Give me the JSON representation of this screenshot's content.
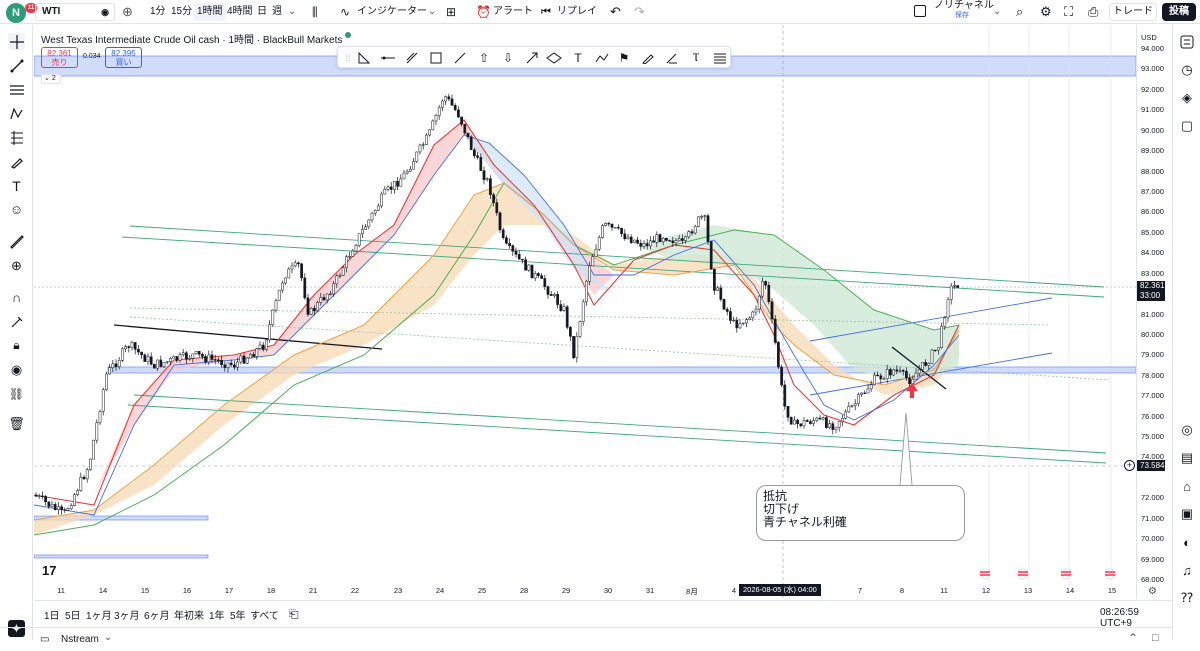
{
  "topbar": {
    "logo_letter": "N",
    "logo_badge": "11",
    "symbol": "WTI",
    "intervals": [
      "1分",
      "15分",
      "1時間",
      "4時間",
      "日",
      "週"
    ],
    "active_interval": "1時間",
    "indicators_label": "インジケーター",
    "alert_label": "アラート",
    "replay_label": "リプレイ",
    "layout_name": "ノリチャネル",
    "layout_status": "保存",
    "trade_label": "トレード",
    "publish_label": "投稿"
  },
  "legend": {
    "title": "West Texas Intermediate Crude Oil cash · 1時間 · BlackBull Markets",
    "sell_price": "82.361",
    "sell_label": "売り",
    "spread": "0.034",
    "buy_price": "82.395",
    "buy_label": "買い",
    "collapse_count": "2"
  },
  "price_axis": {
    "currency": "USD",
    "ticks": [
      "94.000",
      "93.000",
      "92.000",
      "91.000",
      "90.000",
      "89.000",
      "88.000",
      "87.000",
      "86.000",
      "85.000",
      "84.000",
      "83.000",
      "81.000",
      "80.000",
      "79.000",
      "78.000",
      "77.000",
      "76.000",
      "75.000",
      "74.000",
      "72.000",
      "71.000",
      "70.000",
      "69.000",
      "68.000"
    ],
    "last_price": "82.361",
    "last_countdown": "33:00",
    "cursor_price": "73.584"
  },
  "time_axis": {
    "ticks": [
      "11",
      "14",
      "15",
      "16",
      "17",
      "18",
      "21",
      "22",
      "23",
      "24",
      "25",
      "28",
      "29",
      "30",
      "31",
      "8月",
      "4",
      "7",
      "8",
      "11",
      "12",
      "13",
      "14",
      "15"
    ],
    "cursor_label": "2026-08-05 (水)  04:00"
  },
  "note": {
    "lines": [
      "抵抗",
      "切下げ",
      "青チャネル利確"
    ]
  },
  "bottombar": {
    "ranges": [
      "1日",
      "5日",
      "1ヶ月",
      "3ヶ月",
      "6ヶ月",
      "年初来",
      "1年",
      "5年",
      "すべて"
    ],
    "clock": "08:26:59 UTC+9"
  },
  "status": {
    "panel_label": "Nstream"
  },
  "colors": {
    "up": "#26a69a",
    "down": "#ef5350",
    "accent": "#2962ff",
    "candle": "#131722"
  }
}
